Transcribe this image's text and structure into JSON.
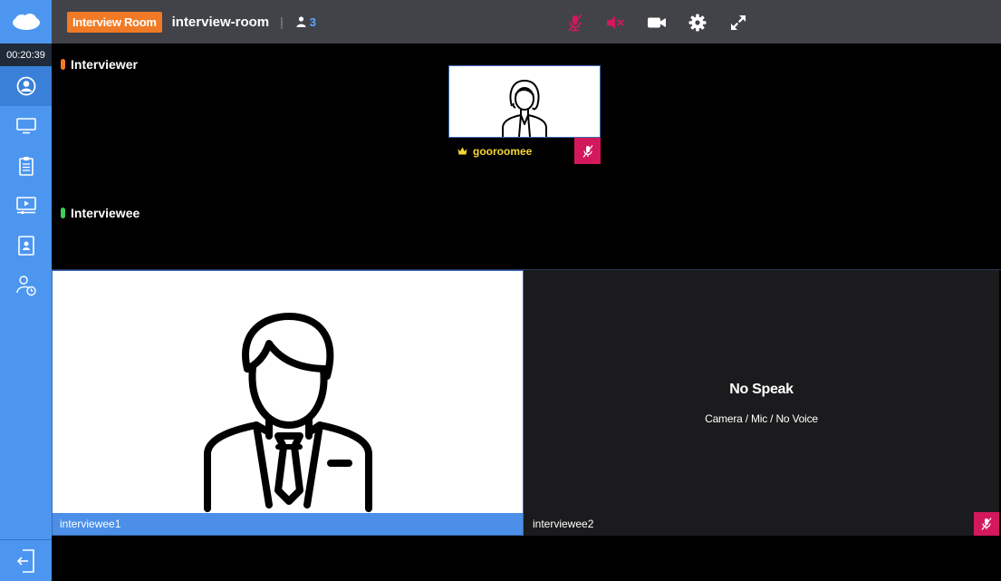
{
  "header": {
    "badge": "Interview Room",
    "room_name": "interview-room",
    "separator": "|",
    "participant_count": "3",
    "controls": [
      "mic-muted-icon",
      "speaker-muted-icon",
      "camera-icon",
      "settings-icon",
      "fullscreen-icon"
    ]
  },
  "sidebar": {
    "timer": "00:20:39",
    "items": [
      "participants-icon",
      "screen-share-icon",
      "clipboard-icon",
      "media-player-icon",
      "contact-card-icon",
      "user-schedule-icon"
    ],
    "exit": "exit-icon"
  },
  "sections": {
    "interviewer_label": "Interviewer",
    "interviewee_label": "Interviewee"
  },
  "interviewer": {
    "name": "gooroomee"
  },
  "interviewees": [
    {
      "name": "interviewee1"
    },
    {
      "name": "interviewee2",
      "status_title": "No Speak",
      "status_sub": "Camera / Mic / No Voice"
    }
  ],
  "colors": {
    "topbar": "#414349",
    "sidebar": "#4d96f0",
    "badge": "#f07a25",
    "muted": "#d3185b",
    "interviewer_dot": "#f07a25",
    "interviewee_dot": "#3ccf5a",
    "host_name": "#f5d53a"
  }
}
